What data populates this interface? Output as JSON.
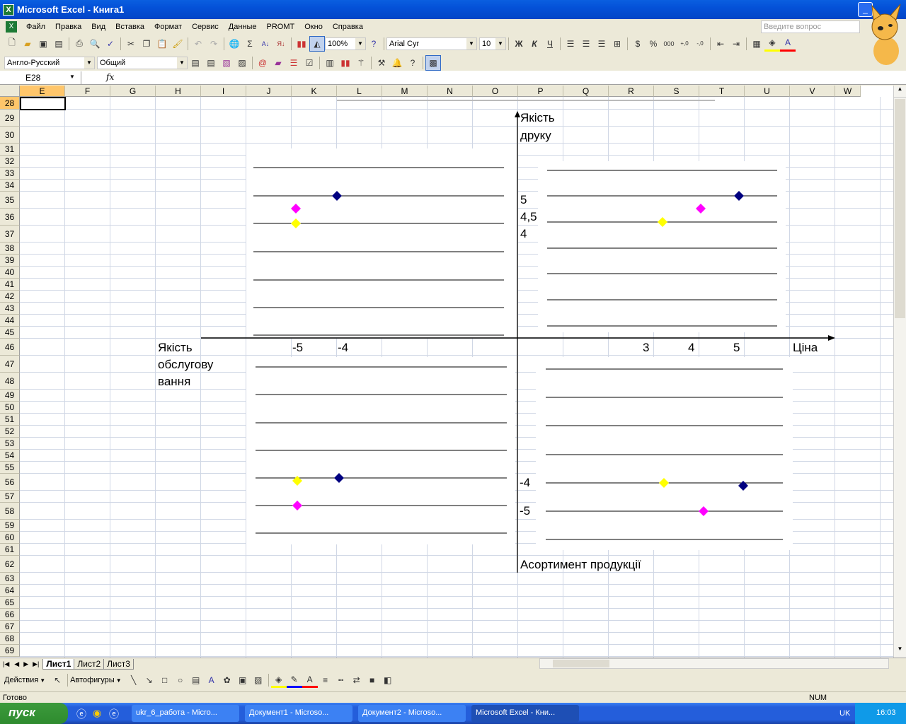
{
  "window": {
    "title": "Microsoft Excel - Книга1"
  },
  "menu": [
    "Файл",
    "Правка",
    "Вид",
    "Вставка",
    "Формат",
    "Сервис",
    "Данные",
    "PROMT",
    "Окно",
    "Справка"
  ],
  "ask_placeholder": "Введите вопрос",
  "toolbar": {
    "zoom": "100%",
    "font": "Arial Cyr",
    "size": "10",
    "bold": "Ж",
    "italic": "К",
    "underline": "Ч",
    "percent": "%",
    "thousands": "000",
    "sigma": "Σ"
  },
  "toolbar2": {
    "dictionary": "Англо-Русский",
    "format": "Общий"
  },
  "formula": {
    "cell": "E28",
    "fx": "fx",
    "value": ""
  },
  "columns": [
    "E",
    "F",
    "G",
    "H",
    "I",
    "J",
    "K",
    "L",
    "M",
    "N",
    "O",
    "P",
    "Q",
    "R",
    "S",
    "T",
    "U",
    "V",
    "W"
  ],
  "rows": [
    28,
    29,
    30,
    31,
    32,
    33,
    34,
    35,
    36,
    37,
    38,
    39,
    40,
    41,
    42,
    43,
    44,
    45,
    46,
    47,
    48,
    49,
    50,
    51,
    52,
    53,
    54,
    55,
    56,
    57,
    58,
    59,
    60,
    61,
    62,
    63,
    64,
    65,
    66,
    67,
    68,
    69
  ],
  "chart_labels": {
    "y_axis_title": [
      "Якість",
      "друку"
    ],
    "y_ticks_top": [
      "5",
      "4,5",
      "4"
    ],
    "x_ticks_left": [
      "-5",
      "-4"
    ],
    "x_ticks_right": [
      "3",
      "4",
      "5"
    ],
    "x_axis_title": "Ціна",
    "left_axis_title": [
      "Якість",
      "обслугову",
      "вання"
    ],
    "y_ticks_bottom": [
      "-4",
      "-5"
    ],
    "bottom_axis_title": "Асортимент продукції"
  },
  "colors": {
    "series1": "#000080",
    "series2": "#ff00ff",
    "series3": "#ffff00"
  },
  "sheets": [
    "Лист1",
    "Лист2",
    "Лист3"
  ],
  "drawing": {
    "actions": "Действия",
    "autoshapes": "Автофигуры"
  },
  "status": {
    "ready": "Готово",
    "num": "NUM"
  },
  "taskbar": {
    "start": "пуск",
    "items": [
      "ukr_6_работа - Micro...",
      "Документ1 - Microso...",
      "Документ2 - Microso...",
      "Microsoft Excel - Кни..."
    ],
    "lang": "UK",
    "clock": "16:03"
  }
}
